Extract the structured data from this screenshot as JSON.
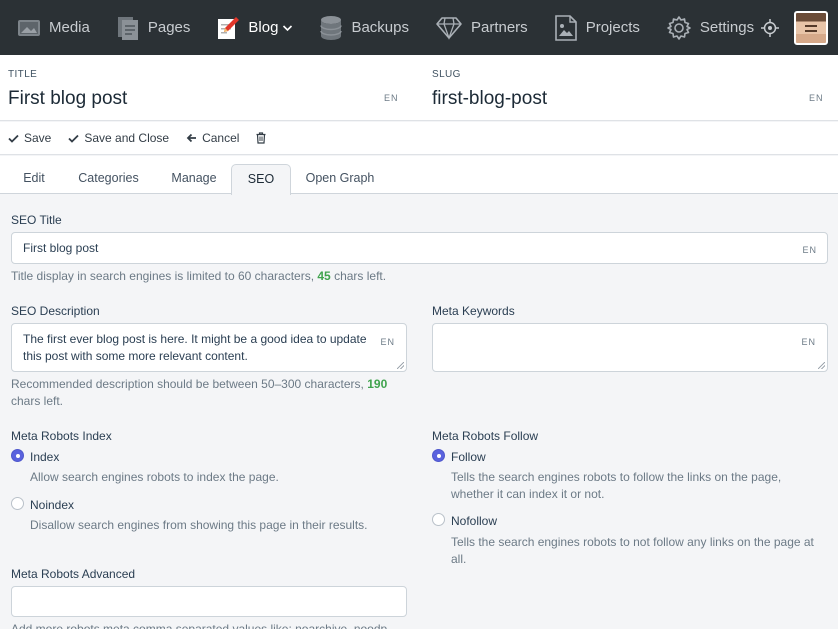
{
  "nav": {
    "items": [
      {
        "label": "Media",
        "icon": "media-icon"
      },
      {
        "label": "Pages",
        "icon": "pages-icon"
      },
      {
        "label": "Blog",
        "icon": "blog-icon",
        "active": true
      },
      {
        "label": "Backups",
        "icon": "database-icon"
      },
      {
        "label": "Partners",
        "icon": "diamond-icon"
      },
      {
        "label": "Projects",
        "icon": "projects-icon"
      },
      {
        "label": "Settings",
        "icon": "gear-icon"
      }
    ]
  },
  "header": {
    "title_label": "TITLE",
    "title_value": "First blog post",
    "title_lang": "EN",
    "slug_label": "SLUG",
    "slug_value": "first-blog-post",
    "slug_lang": "EN"
  },
  "toolbar": {
    "save": "Save",
    "save_close": "Save and Close",
    "cancel": "Cancel"
  },
  "tabs": [
    "Edit",
    "Categories",
    "Manage",
    "SEO",
    "Open Graph"
  ],
  "form": {
    "seo_title": {
      "label": "SEO Title",
      "value": "First blog post",
      "lang": "EN",
      "help_pre": "Title display in search engines is limited to 60 characters,",
      "help_count": "45",
      "help_post": "chars left."
    },
    "seo_description": {
      "label": "SEO Description",
      "value_line1": "The first ever blog post is here. It might be a good idea to update",
      "value_line2": "this post with some more relevant content.",
      "lang": "EN",
      "help_pre": "Recommended description should be between 50–300 characters,",
      "help_count": "190",
      "help_post": "chars left."
    },
    "meta_keywords": {
      "label": "Meta Keywords",
      "lang": "EN"
    },
    "robots_index": {
      "label": "Meta Robots Index",
      "options": [
        {
          "label": "Index",
          "help": "Allow search engines robots to index the page.",
          "checked": true
        },
        {
          "label": "Noindex",
          "help": "Disallow search engines from showing this page in their results.",
          "checked": false
        }
      ]
    },
    "robots_follow": {
      "label": "Meta Robots Follow",
      "options": [
        {
          "label": "Follow",
          "help1": "Tells the search engines robots to follow the links on the page,",
          "help2": "whether it can index it or not.",
          "checked": true
        },
        {
          "label": "Nofollow",
          "help1": "Tells the search engines robots to not follow any links on the page at",
          "help2": "all.",
          "checked": false
        }
      ]
    },
    "robots_advanced": {
      "label": "Meta Robots Advanced",
      "help": "Add more robots meta comma separated values like: noarchive, noodp"
    }
  },
  "colors": {
    "nav_bg": "#2b3135",
    "accent": "#5a62de",
    "count_green": "#3fa34d"
  }
}
